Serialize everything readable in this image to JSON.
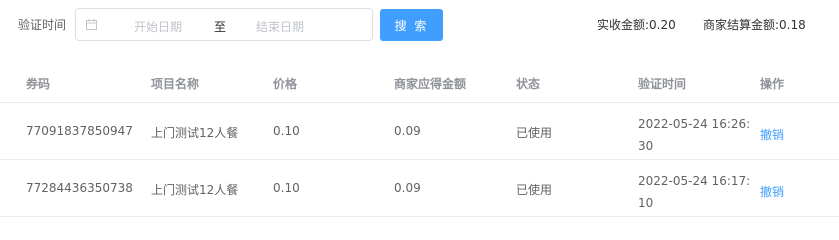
{
  "filter": {
    "label": "验证时间",
    "start_placeholder": "开始日期",
    "separator": "至",
    "end_placeholder": "结束日期",
    "search_label": "搜 索",
    "actual_amount": "实收金额:0.20",
    "settle_amount": "商家结算金额:0.18"
  },
  "table": {
    "headers": [
      "券码",
      "项目名称",
      "价格",
      "商家应得金额",
      "状态",
      "验证时间",
      "操作"
    ],
    "rows": [
      {
        "code": "77091837850947",
        "name": "上门测试12人餐",
        "price": "0.10",
        "merchant_amount": "0.09",
        "status": "已使用",
        "time": "2022-05-24 16:26:30",
        "action": "撤销"
      },
      {
        "code": "77284436350738",
        "name": "上门测试12人餐",
        "price": "0.10",
        "merchant_amount": "0.09",
        "status": "已使用",
        "time": "2022-05-24 16:17:10",
        "action": "撤销"
      }
    ]
  }
}
